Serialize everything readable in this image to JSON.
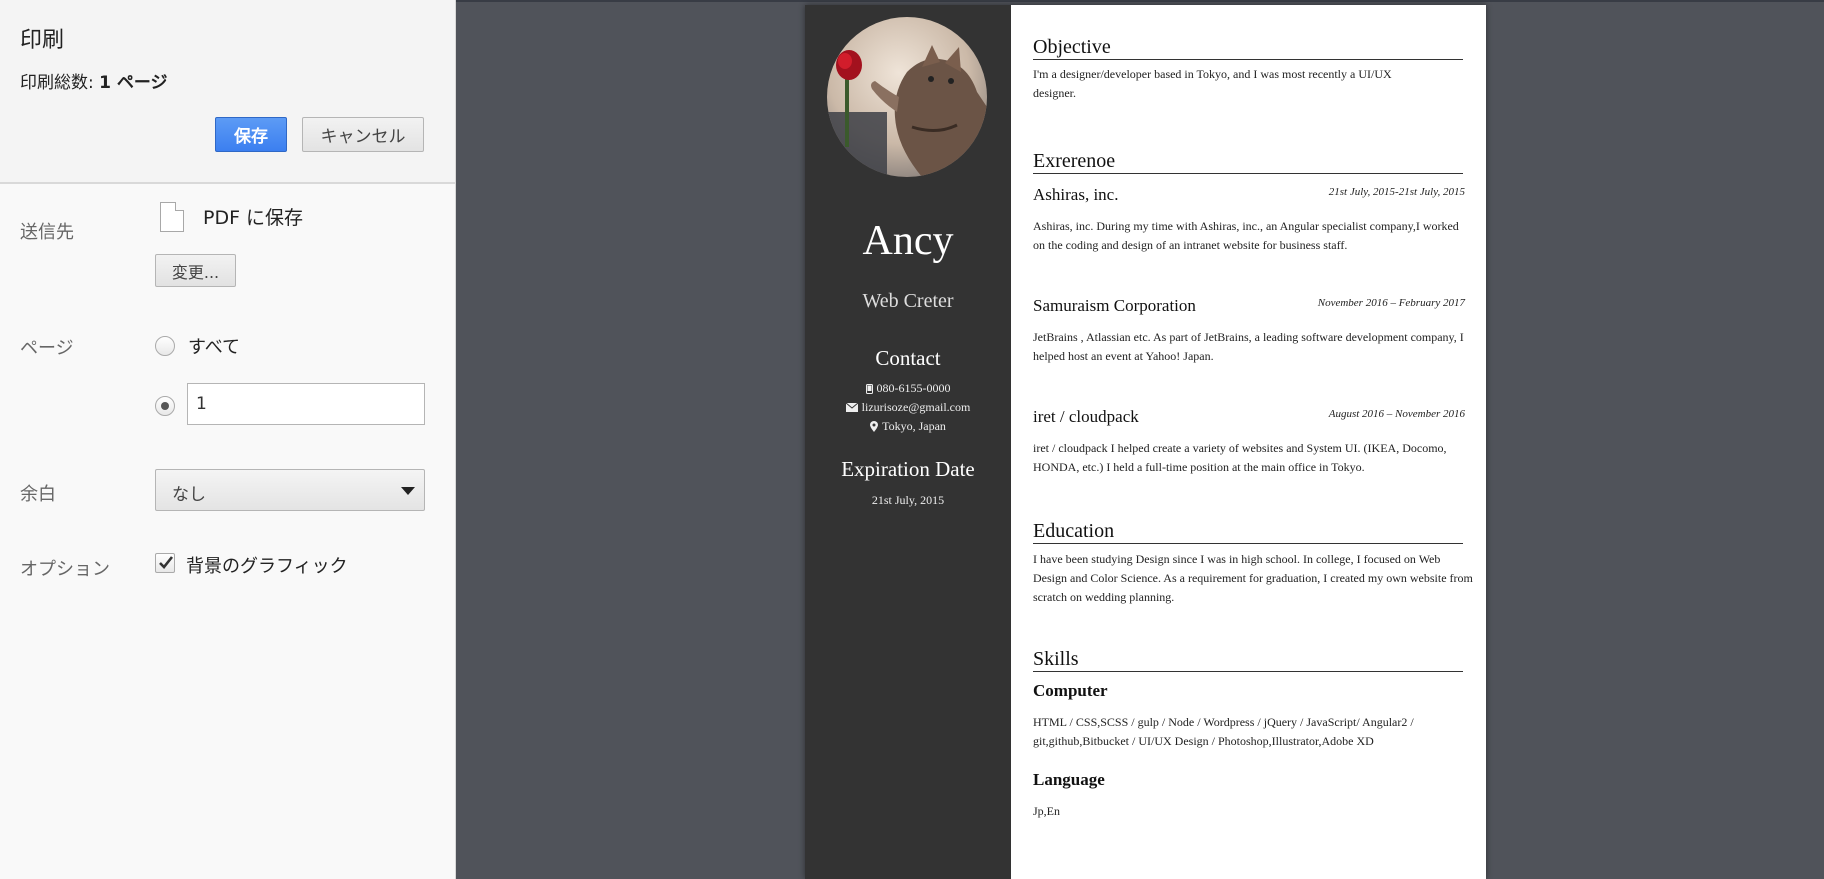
{
  "print_panel": {
    "title": "印刷",
    "total_pages_label": "印刷総数:",
    "total_pages_value": "1 ページ",
    "save_button": "保存",
    "cancel_button": "キャンセル",
    "destination": {
      "label": "送信先",
      "value": "PDF に保存",
      "change_button": "変更...",
      "icon": "document-icon"
    },
    "pages": {
      "label": "ページ",
      "option_all": "すべて",
      "option_all_selected": false,
      "range_selected": true,
      "range_value": "1"
    },
    "margins": {
      "label": "余白",
      "selected": "なし"
    },
    "options": {
      "label": "オプション",
      "background_graphics": "背景のグラフィック",
      "background_graphics_checked": true
    }
  },
  "resume": {
    "sidebar": {
      "name": "Ancy",
      "role": "Web Creter",
      "contact_heading": "Contact",
      "phone": "080-6155-0000",
      "email": "lizurisoze@gmail.com",
      "location": "Tokyo, Japan",
      "expiration_heading": "Expiration Date",
      "expiration_value": "21st July, 2015"
    },
    "objective": {
      "title": "Objective",
      "text": "I'm a designer/developer based in Tokyo, and I was most recently a UI/UX designer."
    },
    "experience": {
      "title": "Exrerenoe",
      "jobs": [
        {
          "company": "Ashiras, inc.",
          "date": "21st July, 2015-21st July, 2015",
          "text": "Ashiras, inc. During my time with Ashiras, inc., an Angular specialist company,I worked on the coding and design of an intranet website for business staff."
        },
        {
          "company": "Samuraism Corporation",
          "date": "November 2016 – February 2017",
          "text": "JetBrains , Atlassian etc. As part of JetBrains, a leading software development company, I helped host an event at Yahoo! Japan."
        },
        {
          "company": "iret / cloudpack",
          "date": "August 2016 – November 2016",
          "text": "iret / cloudpack I helped create a variety of websites and System UI. (IKEA, Docomo, HONDA, etc.) I held a full-time position at the main office in Tokyo."
        }
      ]
    },
    "education": {
      "title": "Education",
      "text": "I have been studying Design since I was in high school. In college, I focused on Web Design and Color Science. As a requirement for graduation, I created my own website from scratch on wedding planning."
    },
    "skills": {
      "title": "Skills",
      "computer_title": "Computer",
      "computer_text": "HTML / CSS,SCSS / gulp / Node / Wordpress / jQuery / JavaScript/ Angular2 / git,github,Bitbucket / UI/UX Design / Photoshop,Illustrator,Adobe XD",
      "language_title": "Language",
      "language_text": "Jp,En"
    }
  }
}
